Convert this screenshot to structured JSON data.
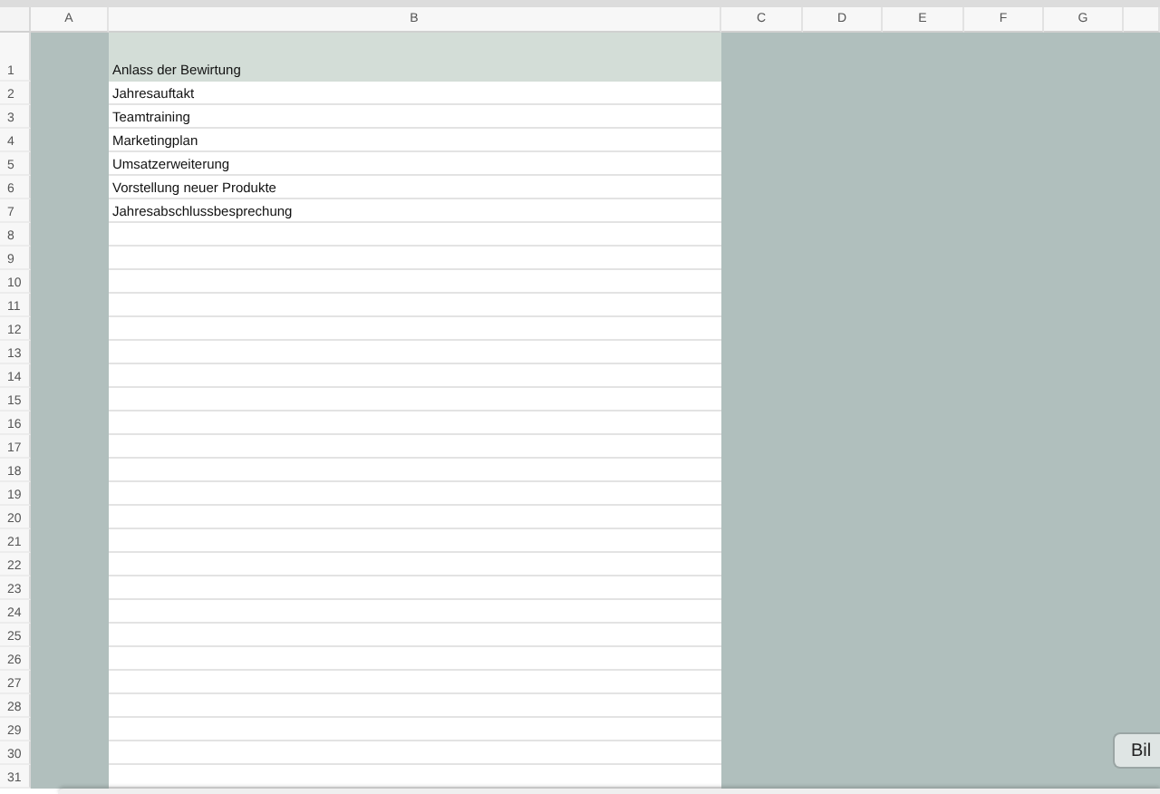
{
  "columns": [
    "A",
    "B",
    "C",
    "D",
    "E",
    "F",
    "G"
  ],
  "rows": [
    {
      "number": "1",
      "text": "Anlass der Bewirtung",
      "kind": "header"
    },
    {
      "number": "2",
      "text": "Jahresauftakt",
      "kind": "data"
    },
    {
      "number": "3",
      "text": "Teamtraining",
      "kind": "data"
    },
    {
      "number": "4",
      "text": "Marketingplan",
      "kind": "data"
    },
    {
      "number": "5",
      "text": "Umsatzerweiterung",
      "kind": "data"
    },
    {
      "number": "6",
      "text": "Vorstellung neuer Produkte",
      "kind": "data"
    },
    {
      "number": "7",
      "text": "Jahresabschlussbesprechung",
      "kind": "data"
    },
    {
      "number": "8",
      "kind": "data"
    },
    {
      "number": "9",
      "kind": "data"
    },
    {
      "number": "10",
      "kind": "data"
    },
    {
      "number": "11",
      "kind": "data"
    },
    {
      "number": "12",
      "kind": "data"
    },
    {
      "number": "13",
      "kind": "data"
    },
    {
      "number": "14",
      "kind": "data"
    },
    {
      "number": "15",
      "kind": "data"
    },
    {
      "number": "16",
      "kind": "data"
    },
    {
      "number": "17",
      "kind": "data"
    },
    {
      "number": "18",
      "kind": "data"
    },
    {
      "number": "19",
      "kind": "data"
    },
    {
      "number": "20",
      "kind": "data"
    },
    {
      "number": "21",
      "kind": "data"
    },
    {
      "number": "22",
      "kind": "data"
    },
    {
      "number": "23",
      "kind": "data"
    },
    {
      "number": "24",
      "kind": "data"
    },
    {
      "number": "25",
      "kind": "data"
    },
    {
      "number": "26",
      "kind": "data"
    },
    {
      "number": "27",
      "kind": "data"
    },
    {
      "number": "28",
      "kind": "data"
    },
    {
      "number": "29",
      "kind": "data"
    },
    {
      "number": "30",
      "kind": "data"
    },
    {
      "number": "31",
      "kind": "data"
    }
  ],
  "floating_button": {
    "label": "Bil"
  }
}
